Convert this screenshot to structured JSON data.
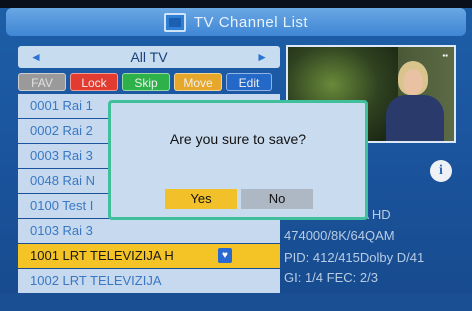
{
  "window": {
    "title": "TV Channel List"
  },
  "nav": {
    "group_label": "All TV",
    "left_arrow": "◄",
    "right_arrow": "►"
  },
  "function_buttons": [
    {
      "label": "FAV",
      "color": "#9a9a9a"
    },
    {
      "label": "Lock",
      "color": "#e23b2f"
    },
    {
      "label": "Skip",
      "color": "#2fb14a"
    },
    {
      "label": "Move",
      "color": "#e6a72a"
    },
    {
      "label": "Edit",
      "color": "#2468c8"
    }
  ],
  "channels": [
    {
      "label": "0001 Rai 1"
    },
    {
      "label": "0002 Rai 2"
    },
    {
      "label": "0003 Rai 3"
    },
    {
      "label": "0048 Rai N"
    },
    {
      "label": "0100 Test I"
    },
    {
      "label": "0103 Rai 3"
    },
    {
      "label": "1001 LRT TELEVIZIJA H"
    },
    {
      "label": "1002 LRT TELEVIZIJA"
    }
  ],
  "selected_index": 6,
  "channel_info": {
    "name": "VIZIJA HD",
    "frequency": "474000/8K/64QAM",
    "pid": "PID: 412/415Dolby D/41",
    "gi_fec": "GI: 1/4   FEC: 2/3"
  },
  "dialog": {
    "message": "Are you sure to save?",
    "yes_label": "Yes",
    "no_label": "No"
  },
  "icons": {
    "tv": "tv-icon",
    "info": "info-icon",
    "fav_badge": "heart-icon"
  },
  "colors": {
    "background": "#1b56a0",
    "accent": "#f4c326",
    "dialog_border": "#3fbf9a"
  }
}
